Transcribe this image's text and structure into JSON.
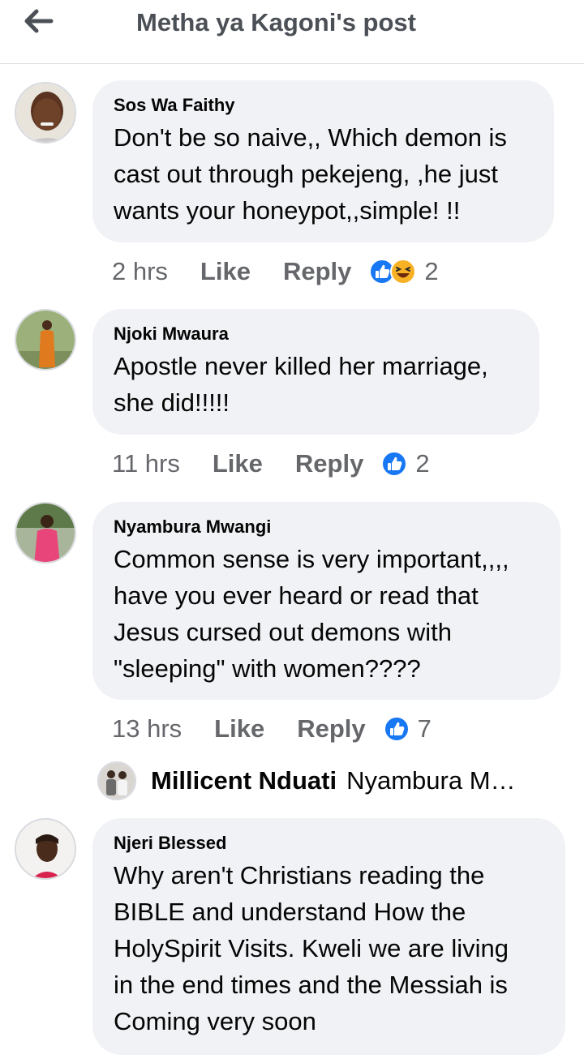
{
  "header": {
    "title": "Metha ya Kagoni's post",
    "back_icon": "back-arrow-icon"
  },
  "colors": {
    "bubble": "#f0f2f5",
    "meta": "#65676b",
    "like_blue": "#1877f2",
    "haha_yellow": "#f7b125"
  },
  "comments": [
    {
      "author": "Sos Wa Faithy",
      "lines": [
        "Don't be so naive,, Which demon is",
        "cast out through pekejeng, ,he just",
        "wants your honeypot,,simple! !!"
      ],
      "time": "2 hrs",
      "like": "Like",
      "reply": "Reply",
      "reactions": [
        "like-reaction-icon",
        "haha-reaction-icon"
      ],
      "reaction_count": "2"
    },
    {
      "author": "Njoki Mwaura",
      "lines": [
        "Apostle never killed her marriage,",
        "she did!!!!!"
      ],
      "time": "11 hrs",
      "like": "Like",
      "reply": "Reply",
      "reactions": [
        "like-reaction-icon"
      ],
      "reaction_count": "2"
    },
    {
      "author": "Nyambura Mwangi",
      "lines": [
        "Common sense is very important,,,,",
        "have you ever heard or read that",
        "Jesus cursed out demons with",
        "\"sleeping\" with women????"
      ],
      "time": "13 hrs",
      "like": "Like",
      "reply": "Reply",
      "reactions": [
        "like-reaction-icon"
      ],
      "reaction_count": "7",
      "reply_preview": {
        "name": "Millicent Nduati",
        "snippet": "Nyambura M…"
      }
    },
    {
      "author": "Njeri Blessed",
      "lines": [
        "Why aren't Christians reading the",
        "BIBLE and understand How the",
        "HolySpirit Visits. Kweli we are living",
        "in the end times and the Messiah is",
        "Coming very soon"
      ]
    }
  ]
}
